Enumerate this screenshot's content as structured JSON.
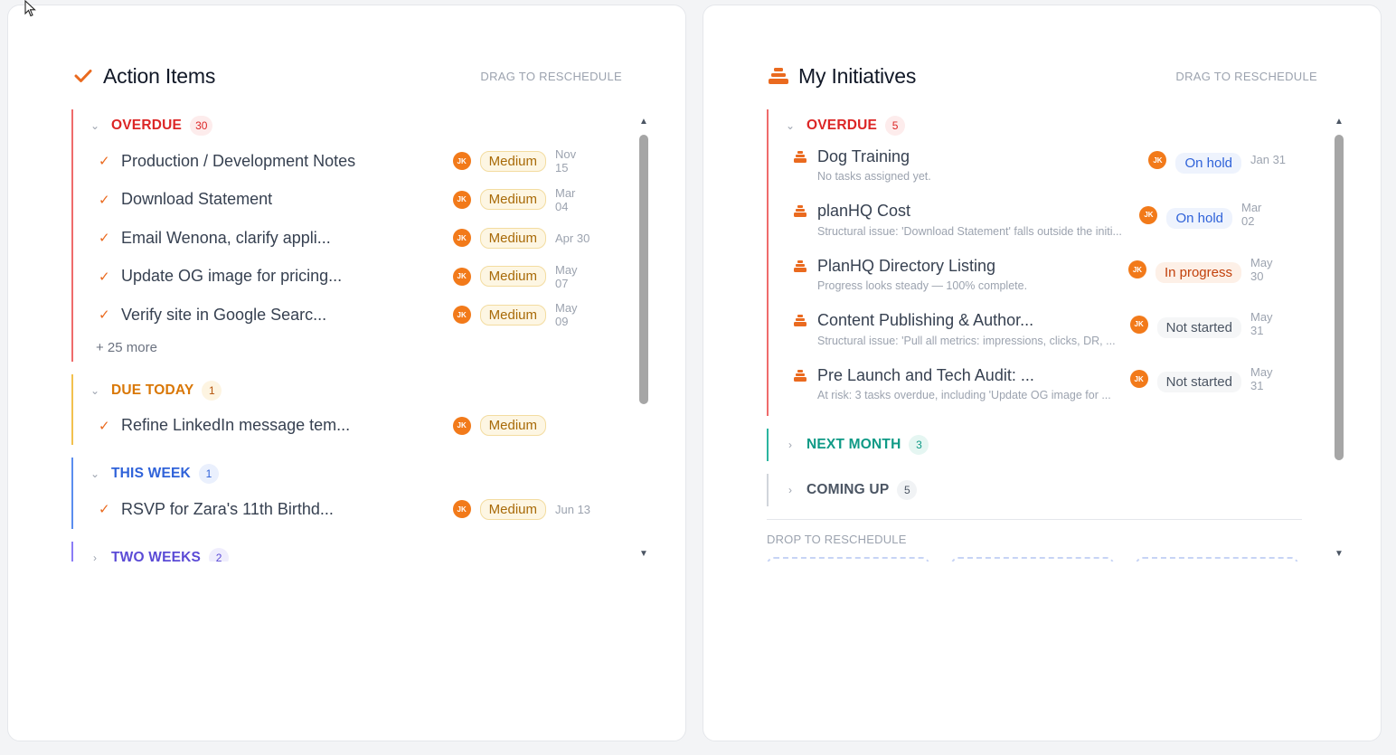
{
  "action_items": {
    "title": "Action Items",
    "drag_hint": "DRAG TO RESCHEDULE",
    "groups": {
      "overdue": {
        "label": "OVERDUE",
        "count": "30",
        "tasks": [
          {
            "title": "Production / Development Notes",
            "avatar": "JK",
            "priority": "Medium",
            "date": "Nov 15"
          },
          {
            "title": "Download Statement",
            "avatar": "JK",
            "priority": "Medium",
            "date": "Mar 04"
          },
          {
            "title": "Email Wenona, clarify appli...",
            "avatar": "JK",
            "priority": "Medium",
            "date": "Apr 30"
          },
          {
            "title": "Update OG image for pricing...",
            "avatar": "JK",
            "priority": "Medium",
            "date": "May 07"
          },
          {
            "title": "Verify site in Google Searc...",
            "avatar": "JK",
            "priority": "Medium",
            "date": "May 09"
          }
        ],
        "more": "+ 25 more"
      },
      "today": {
        "label": "DUE TODAY",
        "count": "1",
        "tasks": [
          {
            "title": "Refine LinkedIn message tem...",
            "avatar": "JK",
            "priority": "Medium",
            "date": ""
          }
        ]
      },
      "week": {
        "label": "THIS WEEK",
        "count": "1",
        "tasks": [
          {
            "title": "RSVP for Zara's 11th Birthd...",
            "avatar": "JK",
            "priority": "Medium",
            "date": "Jun 13"
          }
        ]
      },
      "twoweeks": {
        "label": "TWO WEEKS",
        "count": "2"
      }
    }
  },
  "initiatives": {
    "title": "My Initiatives",
    "drag_hint": "DRAG TO RESCHEDULE",
    "groups": {
      "overdue": {
        "label": "OVERDUE",
        "count": "5",
        "items": [
          {
            "title": "Dog Training",
            "sub": "No tasks assigned yet.",
            "avatar": "JK",
            "status": "On hold",
            "date": "Jan 31"
          },
          {
            "title": "planHQ Cost",
            "sub": "Structural issue: 'Download Statement' falls outside the initi...",
            "avatar": "JK",
            "status": "On hold",
            "date": "Mar 02"
          },
          {
            "title": "PlanHQ Directory Listing",
            "sub": "Progress looks steady — 100% complete.",
            "avatar": "JK",
            "status": "In progress",
            "date": "May 30"
          },
          {
            "title": "Content Publishing & Author...",
            "sub": "Structural issue: 'Pull all metrics: impressions, clicks, DR, ...",
            "avatar": "JK",
            "status": "Not started",
            "date": "May 31"
          },
          {
            "title": "Pre Launch and Tech Audit: ...",
            "sub": "At risk: 3 tasks overdue, including 'Update OG image for ...",
            "avatar": "JK",
            "status": "Not started",
            "date": "May 31"
          }
        ]
      },
      "nextmonth": {
        "label": "NEXT MONTH",
        "count": "3"
      },
      "coming": {
        "label": "COMING UP",
        "count": "5"
      }
    },
    "drop_label": "DROP TO RESCHEDULE"
  },
  "icons": {
    "check": "check-icon",
    "initiative": "stack-icon",
    "cursor": "cursor-icon"
  },
  "colors": {
    "accent": "#ea6a1f",
    "overdue": "#dc2626",
    "today": "#d97706",
    "week": "#2f62d9",
    "nextmonth": "#0f9a86"
  }
}
